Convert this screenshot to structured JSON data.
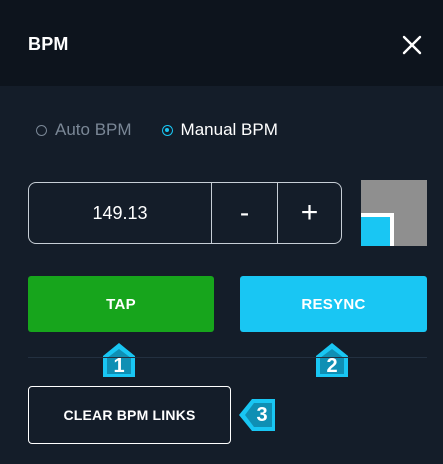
{
  "header": {
    "title": "BPM",
    "close_icon": "close-icon"
  },
  "mode": {
    "options": [
      {
        "label": "Auto BPM",
        "selected": false
      },
      {
        "label": "Manual BPM",
        "selected": true
      }
    ]
  },
  "bpm": {
    "value": "149.13",
    "decrement_label": "-",
    "increment_label": "+"
  },
  "buttons": {
    "tap_label": "TAP",
    "resync_label": "RESYNC",
    "clear_label": "CLEAR BPM LINKS"
  },
  "callouts": {
    "one": "1",
    "two": "2",
    "three": "3"
  },
  "colors": {
    "accent": "#19c6f3",
    "tap_green": "#17a51c",
    "background": "#141d29",
    "header": "#0d141d"
  }
}
